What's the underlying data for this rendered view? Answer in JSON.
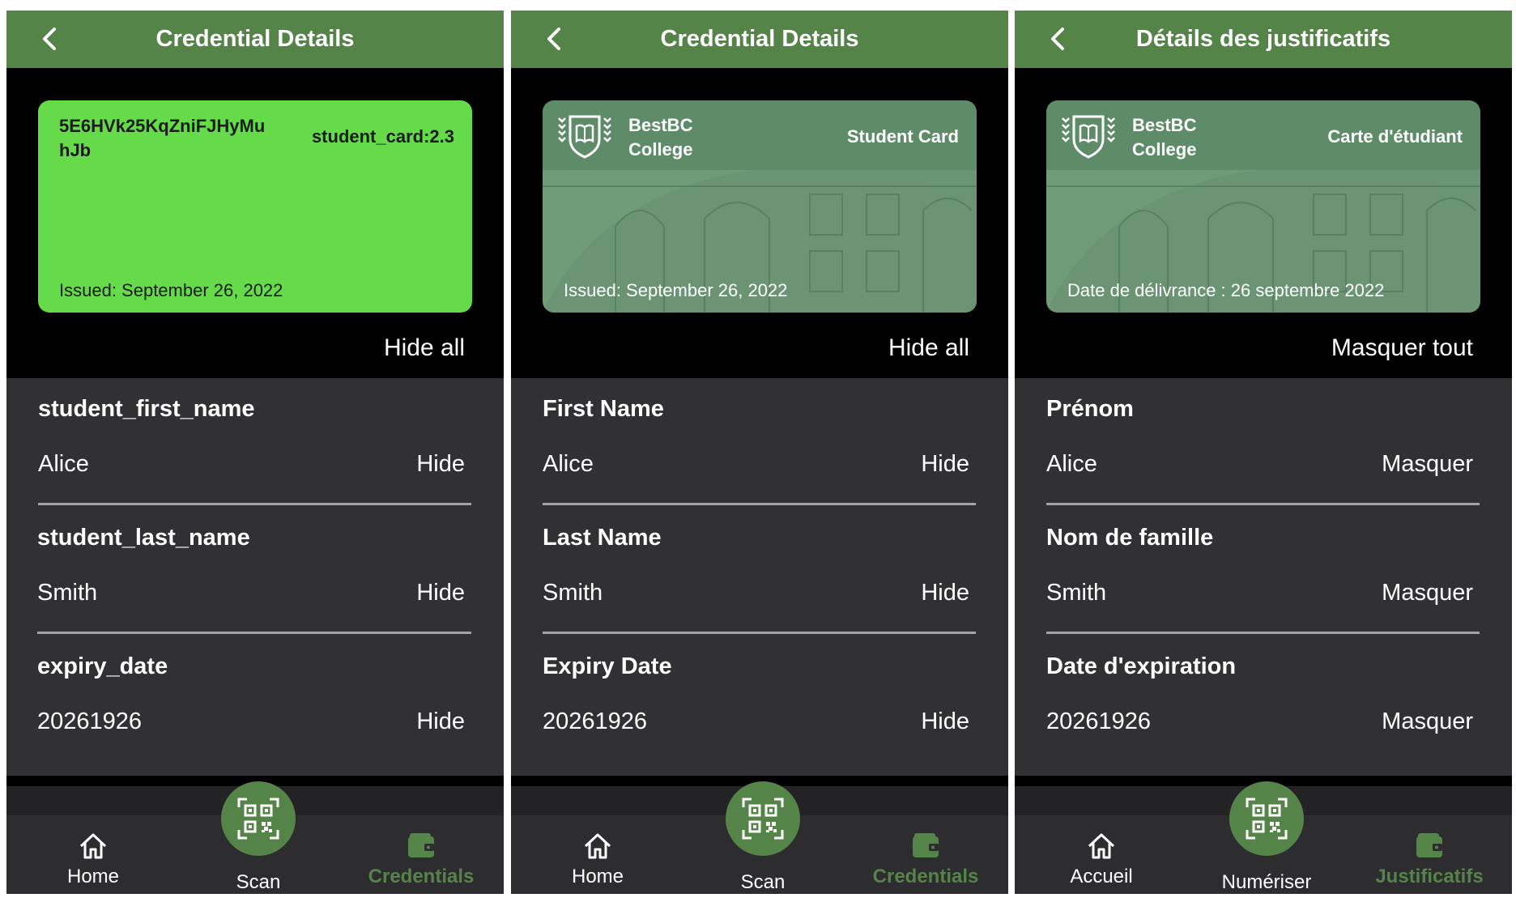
{
  "colors": {
    "header_green": "#548447",
    "plain_card_green": "#66db4a",
    "branded_card_green": "#5e8c69",
    "attributes_bg": "#313133",
    "active_nav": "#548447"
  },
  "panels": [
    {
      "header_title": "Credential Details",
      "card": {
        "variant": "plain",
        "id_text": "5E6HVk25KqZniFJHyMuhJb",
        "type_text": "student_card:2.3",
        "issued_text": "Issued: September 26, 2022"
      },
      "hide_all_label": "Hide all",
      "attributes": [
        {
          "label": "student_first_name",
          "value": "Alice",
          "hide_label": "Hide"
        },
        {
          "label": "student_last_name",
          "value": "Smith",
          "hide_label": "Hide"
        },
        {
          "label": "expiry_date",
          "value": "20261926",
          "hide_label": "Hide"
        }
      ],
      "nav": {
        "home": "Home",
        "scan": "Scan",
        "credentials": "Credentials"
      }
    },
    {
      "header_title": "Credential Details",
      "card": {
        "variant": "branded",
        "brand_line1": "BestBC",
        "brand_line2": "College",
        "type_text": "Student Card",
        "issued_text": "Issued: September 26, 2022"
      },
      "hide_all_label": "Hide all",
      "attributes": [
        {
          "label": "First Name",
          "value": "Alice",
          "hide_label": "Hide"
        },
        {
          "label": "Last Name",
          "value": "Smith",
          "hide_label": "Hide"
        },
        {
          "label": "Expiry Date",
          "value": "20261926",
          "hide_label": "Hide"
        }
      ],
      "nav": {
        "home": "Home",
        "scan": "Scan",
        "credentials": "Credentials"
      }
    },
    {
      "header_title": "Détails des justificatifs",
      "card": {
        "variant": "branded",
        "brand_line1": "BestBC",
        "brand_line2": "College",
        "type_text": "Carte d'étudiant",
        "issued_text": "Date de délivrance : 26 septembre 2022"
      },
      "hide_all_label": "Masquer tout",
      "attributes": [
        {
          "label": "Prénom",
          "value": "Alice",
          "hide_label": "Masquer"
        },
        {
          "label": "Nom de famille",
          "value": "Smith",
          "hide_label": "Masquer"
        },
        {
          "label": "Date d'expiration",
          "value": "20261926",
          "hide_label": "Masquer"
        }
      ],
      "nav": {
        "home": "Accueil",
        "scan": "Numériser",
        "credentials": "Justificatifs"
      }
    }
  ],
  "icons": {
    "back": "chevron-left-icon",
    "home": "home-icon",
    "scan": "qr-code-icon",
    "credentials": "wallet-icon",
    "brand": "shield-book-logo"
  }
}
